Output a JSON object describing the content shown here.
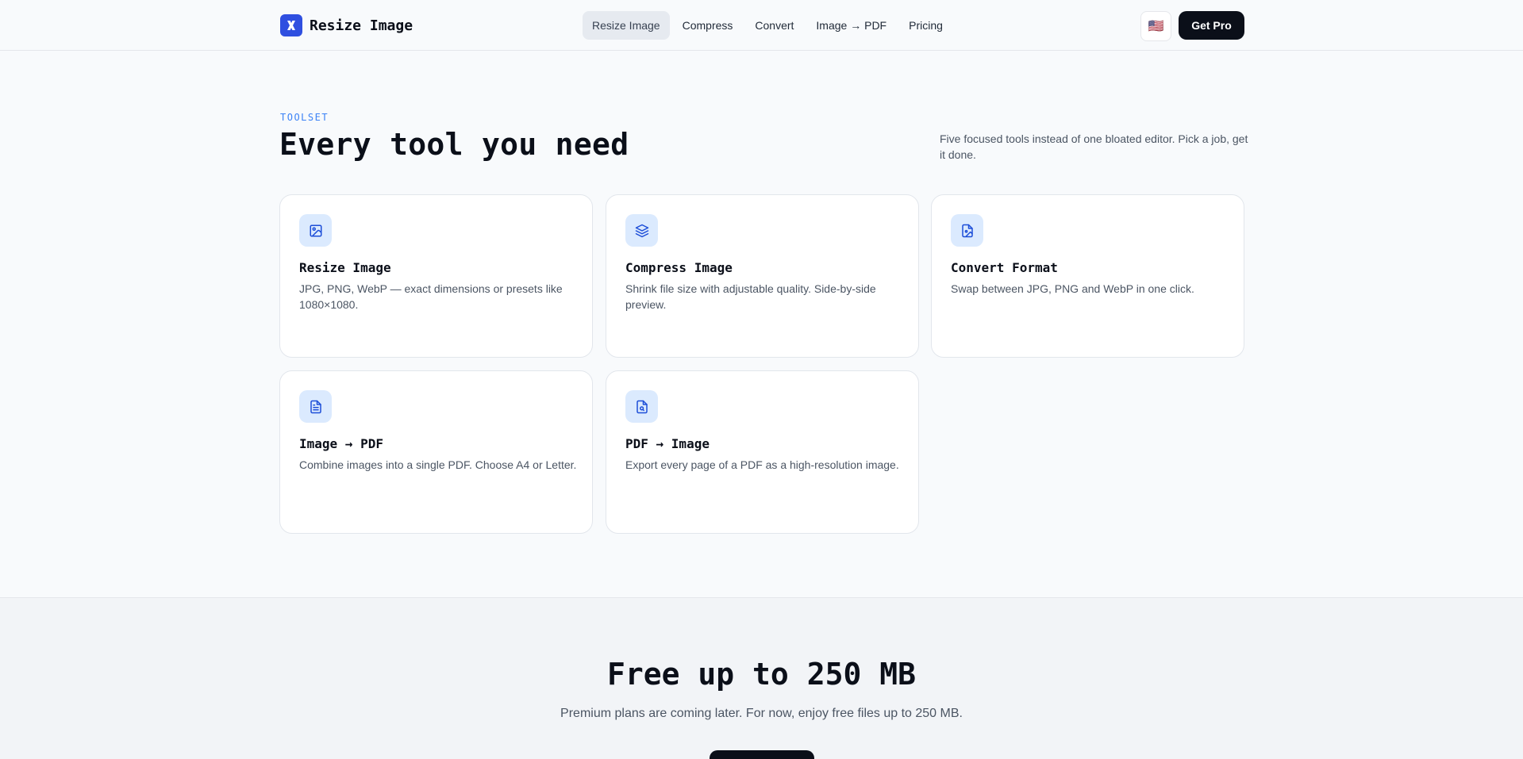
{
  "header": {
    "brand": "Resize Image",
    "nav": [
      {
        "label": "Resize Image",
        "active": true
      },
      {
        "label": "Compress",
        "active": false
      },
      {
        "label": "Convert",
        "active": false
      },
      {
        "label": "Image → PDF",
        "active": false
      },
      {
        "label": "Pricing",
        "active": false
      }
    ],
    "language_flag": "🇺🇸",
    "cta": "Get Pro"
  },
  "toolset": {
    "eyebrow": "TOOLSET",
    "title": "Every tool you need",
    "description": "Five focused tools instead of one bloated editor. Pick a job, get it done.",
    "cards": [
      {
        "icon": "image-icon",
        "title": "Resize Image",
        "desc": "JPG, PNG, WebP — exact dimensions or presets like 1080×1080."
      },
      {
        "icon": "layers-icon",
        "title": "Compress Image",
        "desc": "Shrink file size with adjustable quality. Side-by-side preview."
      },
      {
        "icon": "file-image-icon",
        "title": "Convert Format",
        "desc": "Swap between JPG, PNG and WebP in one click."
      },
      {
        "icon": "file-text-icon",
        "title": "Image → PDF",
        "desc": "Combine images into a single PDF. Choose A4 or Letter."
      },
      {
        "icon": "file-search-icon",
        "title": "PDF → Image",
        "desc": "Export every page of a PDF as a high-resolution image."
      }
    ]
  },
  "free": {
    "title": "Free up to 250 MB",
    "subtitle": "Premium plans are coming later. For now, enjoy free files up to 250 MB."
  },
  "colors": {
    "brand": "#2f4fe0",
    "accent": "#3b82f6",
    "icon_bg": "#dbeafe",
    "dark": "#0b0f19"
  }
}
